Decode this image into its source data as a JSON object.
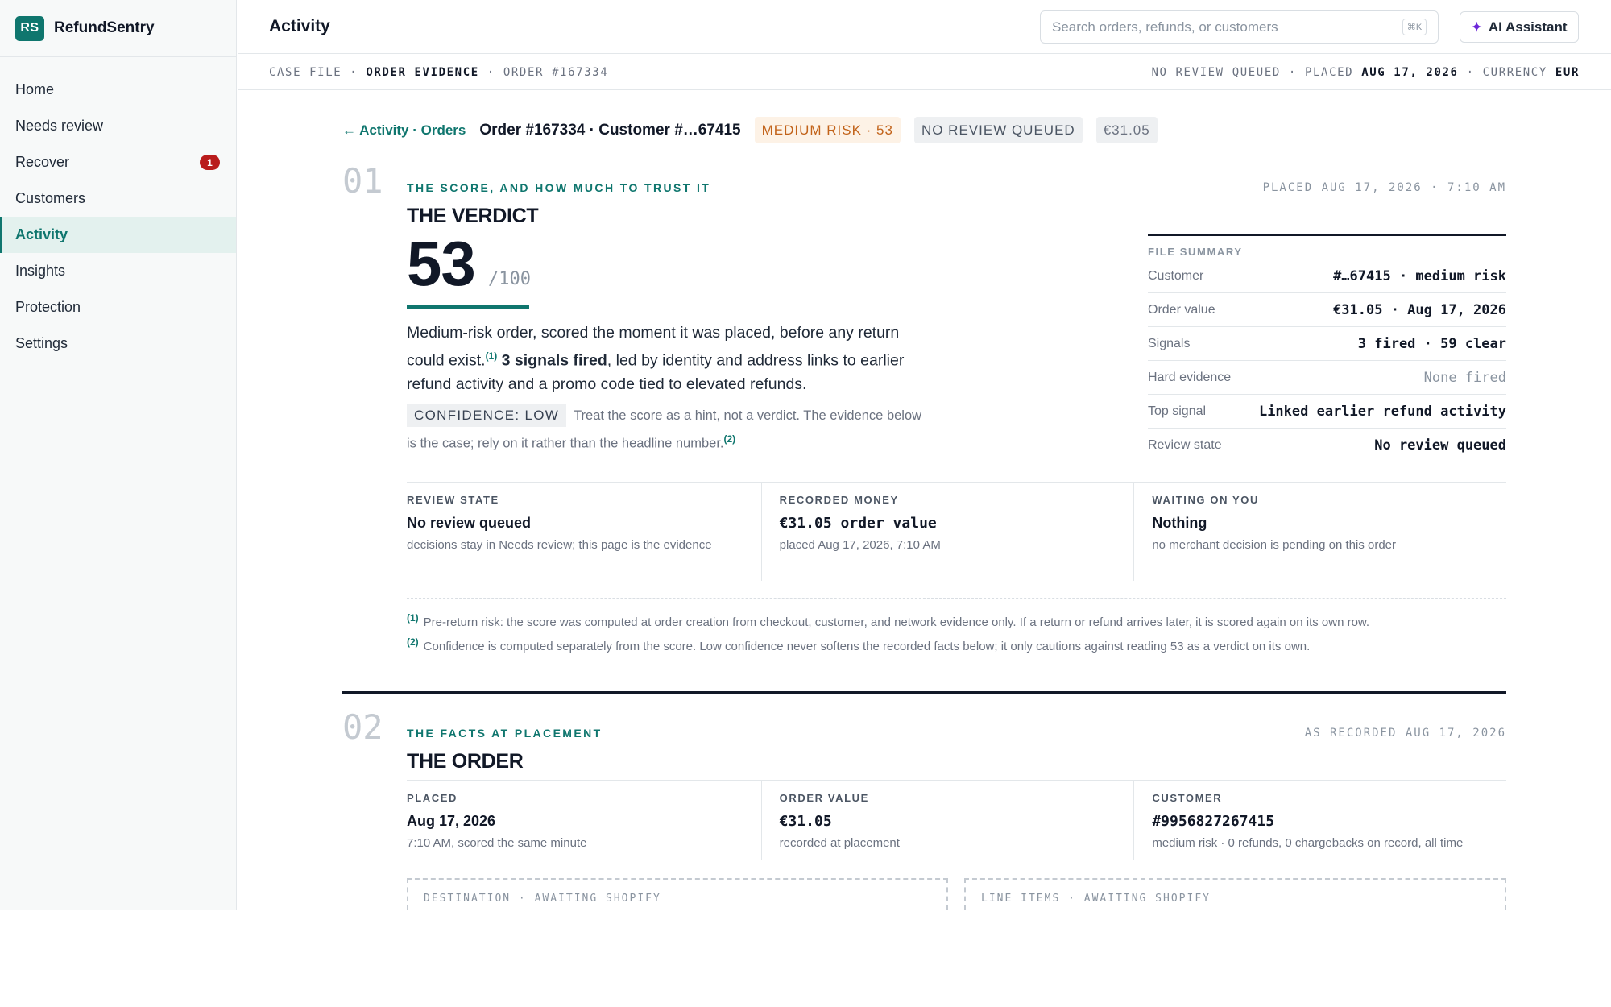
{
  "brand": {
    "logo": "RS",
    "name": "RefundSentry"
  },
  "nav": [
    {
      "label": "Home"
    },
    {
      "label": "Needs review"
    },
    {
      "label": "Recover",
      "badge": "1"
    },
    {
      "label": "Customers"
    },
    {
      "label": "Activity",
      "active": true
    },
    {
      "label": "Insights"
    },
    {
      "label": "Protection"
    },
    {
      "label": "Settings"
    }
  ],
  "topbar": {
    "title": "Activity",
    "search_placeholder": "Search orders, refunds, or customers",
    "search_shortcut": "⌘K",
    "ai_label": "AI Assistant",
    "ai_icon": "sparkle-icon"
  },
  "casebar": {
    "left_prefix": "CASE FILE · ",
    "left_strong": "ORDER EVIDENCE",
    "left_suffix": " · ORDER #167334",
    "right_prefix": "NO REVIEW QUEUED · PLACED ",
    "right_date": "AUG 17, 2026",
    "right_mid": " · CURRENCY ",
    "right_currency": "EUR"
  },
  "crumb": {
    "back": "← Activity · Orders",
    "order_title": "Order #167334 · Customer #…67415",
    "risk_pill": "MEDIUM RISK · 53",
    "review_pill": "NO REVIEW QUEUED",
    "amount_pill": "€31.05"
  },
  "section1": {
    "num": "01",
    "kicker": "THE SCORE, AND HOW MUCH TO TRUST IT",
    "title": "THE VERDICT",
    "stamp": "PLACED AUG 17, 2026 · 7:10 AM",
    "score": "53",
    "score_max": "/100",
    "score_fraction": 0.53,
    "lede_1": "Medium-risk order, scored the moment it was placed, before any return could exist.",
    "lede_ref1": "(1)",
    "lede_bold": "3 signals fired",
    "lede_2": ", led by identity and address links to earlier refund activity and a promo code tied to elevated refunds.",
    "conf_tag": "CONFIDENCE: LOW",
    "conf_text": "Treat the score as a hint, not a verdict. The evidence below is the case; rely on it rather than the headline number.",
    "conf_ref": "(2)",
    "summary": {
      "heading": "FILE SUMMARY",
      "rows": [
        {
          "k": "Customer",
          "v": "#…67415 · medium risk"
        },
        {
          "k": "Order value",
          "v": "€31.05 · Aug 17, 2026"
        },
        {
          "k": "Signals",
          "v": "3 fired · 59 clear"
        },
        {
          "k": "Hard evidence",
          "v": "None fired",
          "muted": true
        },
        {
          "k": "Top signal",
          "v": "Linked earlier refund activity"
        },
        {
          "k": "Review state",
          "v": "No review queued"
        }
      ]
    },
    "stats": [
      {
        "label": "REVIEW STATE",
        "value": "No review queued",
        "sub": "decisions stay in Needs review; this page is the evidence"
      },
      {
        "label": "RECORDED MONEY",
        "value": "€31.05 order value",
        "sub": "placed Aug 17, 2026, 7:10 AM",
        "mono": true
      },
      {
        "label": "WAITING ON YOU",
        "value": "Nothing",
        "sub": "no merchant decision is pending on this order"
      }
    ],
    "footnotes": [
      {
        "ref": "(1)",
        "text": "Pre-return risk: the score was computed at order creation from checkout, customer, and network evidence only. If a return or refund arrives later, it is scored again on its own row."
      },
      {
        "ref": "(2)",
        "text": "Confidence is computed separately from the score. Low confidence never softens the recorded facts below; it only cautions against reading 53 as a verdict on its own."
      }
    ]
  },
  "section2": {
    "num": "02",
    "kicker": "THE FACTS AT PLACEMENT",
    "title": "THE ORDER",
    "stamp": "AS RECORDED AUG 17, 2026",
    "stats": [
      {
        "label": "PLACED",
        "value": "Aug 17, 2026",
        "sub": "7:10 AM, scored the same minute"
      },
      {
        "label": "ORDER VALUE",
        "value": "€31.05",
        "sub": "recorded at placement",
        "mono": true
      },
      {
        "label": "CUSTOMER",
        "value": "#9956827267415",
        "sub": "medium risk · 0 refunds, 0 chargebacks on record, all time",
        "mono": true
      }
    ],
    "pending": [
      {
        "label": "DESTINATION · AWAITING SHOPIFY"
      },
      {
        "label": "LINE ITEMS · AWAITING SHOPIFY"
      }
    ]
  },
  "colors": {
    "accent": "#0f766e",
    "risk": "#c2631a",
    "badge": "#b91c1c",
    "ai": "#6d28d9"
  }
}
